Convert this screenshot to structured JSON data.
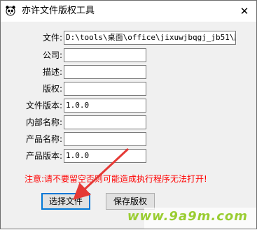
{
  "window": {
    "title": "亦许文件版权工具",
    "close_glyph": "✕"
  },
  "form": {
    "fields": [
      {
        "label": "文件:",
        "value": "D:\\tools\\桌面\\office\\jixuwjbqgj_jb51\\版权"
      },
      {
        "label": "公司:",
        "value": ""
      },
      {
        "label": "描述:",
        "value": ""
      },
      {
        "label": "版权:",
        "value": ""
      },
      {
        "label": "文件版本:",
        "value": "1.0.0"
      },
      {
        "label": "内部名称:",
        "value": ""
      },
      {
        "label": "产品名称:",
        "value": ""
      },
      {
        "label": "产品版本:",
        "value": "1.0.0"
      }
    ]
  },
  "warning": "注意:请不要留空否则可能造成执行程序无法打开!",
  "buttons": {
    "select_file": "选择文件",
    "save_copyright": "保存版权"
  },
  "watermark": "www.9a9m.com",
  "colors": {
    "warning": "#ff0000",
    "focus": "#0078d7",
    "arrow": "#e53935",
    "watermark": "#9acd32"
  },
  "icons": {
    "app": "panda-icon",
    "close": "close-icon",
    "annotation": "red-arrow"
  }
}
